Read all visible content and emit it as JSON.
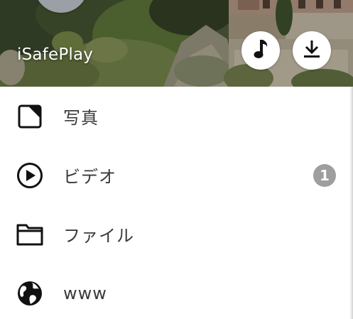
{
  "app": {
    "title": "iSafePlay"
  },
  "header": {
    "music_icon": "music-note-icon",
    "download_icon": "download-icon"
  },
  "menu": {
    "items": [
      {
        "label": "写真",
        "icon": "photo-icon",
        "badge": null
      },
      {
        "label": "ビデオ",
        "icon": "play-circle-icon",
        "badge": "1"
      },
      {
        "label": "ファイル",
        "icon": "folder-icon",
        "badge": null
      },
      {
        "label": "www",
        "icon": "globe-icon",
        "badge": null
      }
    ]
  },
  "colors": {
    "badge": "#9e9e9e",
    "label_text": "#3a3a3a",
    "icon": "#111111"
  }
}
